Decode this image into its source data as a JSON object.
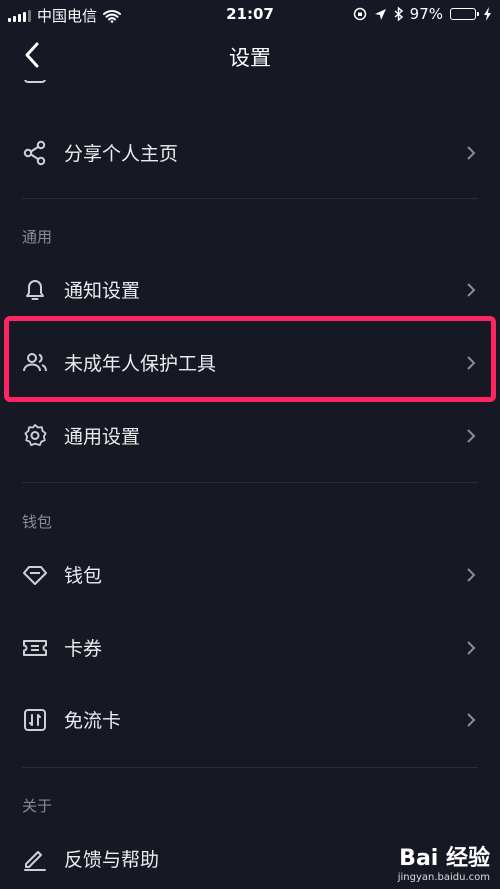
{
  "status_bar": {
    "carrier": "中国电信",
    "time": "21:07",
    "battery": "97%",
    "battery_level": 0.97
  },
  "nav": {
    "title": "设置"
  },
  "items": {
    "share_profile": "分享个人主页",
    "notifications": "通知设置",
    "minor_protection": "未成年人保护工具",
    "general_settings": "通用设置",
    "wallet": "钱包",
    "coupons": "卡券",
    "free_data_card": "免流卡",
    "feedback": "反馈与帮助"
  },
  "sections": {
    "general": "通用",
    "wallet": "钱包",
    "about": "关于"
  },
  "watermark": {
    "logo": "Bai 经验",
    "url": "jingyan.baidu.com"
  },
  "colors": {
    "background": "#161823",
    "highlight": "#ff2462",
    "battery": "#4cd964"
  }
}
